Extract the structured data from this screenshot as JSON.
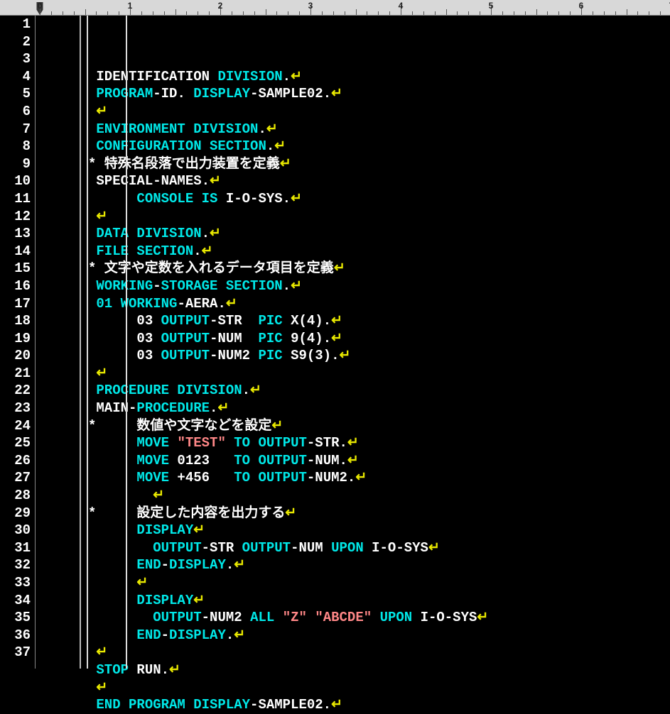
{
  "ruler": {
    "max": 7
  },
  "lines": [
    {
      "n": 1,
      "ind": 0,
      "tokens": [
        {
          "t": "IDENTIFICATION ",
          "c": "w"
        },
        {
          "t": "DIVISION",
          "c": "c"
        },
        {
          "t": ".",
          "c": "w"
        },
        {
          "t": "↵",
          "c": "y"
        }
      ]
    },
    {
      "n": 2,
      "ind": 0,
      "tokens": [
        {
          "t": "PROGRAM",
          "c": "c"
        },
        {
          "t": "-ID. ",
          "c": "w"
        },
        {
          "t": "DISPLAY",
          "c": "c"
        },
        {
          "t": "-SAMPLE02.",
          "c": "w"
        },
        {
          "t": "↵",
          "c": "y"
        }
      ]
    },
    {
      "n": 3,
      "ind": 0,
      "tokens": [
        {
          "t": "↵",
          "c": "y"
        }
      ]
    },
    {
      "n": 4,
      "ind": 0,
      "tokens": [
        {
          "t": "ENVIRONMENT DIVISION",
          "c": "c"
        },
        {
          "t": ".",
          "c": "w"
        },
        {
          "t": "↵",
          "c": "y"
        }
      ]
    },
    {
      "n": 5,
      "ind": 0,
      "tokens": [
        {
          "t": "CONFIGURATION SECTION",
          "c": "c"
        },
        {
          "t": ".",
          "c": "w"
        },
        {
          "t": "↵",
          "c": "y"
        }
      ]
    },
    {
      "n": 6,
      "ind": -1,
      "tokens": [
        {
          "t": "* 特殊名段落で出力装置を定義",
          "c": "w"
        },
        {
          "t": "↵",
          "c": "y"
        }
      ]
    },
    {
      "n": 7,
      "ind": 0,
      "tokens": [
        {
          "t": "SPECIAL-NAMES.",
          "c": "w"
        },
        {
          "t": "↵",
          "c": "y"
        }
      ]
    },
    {
      "n": 8,
      "ind": 1,
      "tokens": [
        {
          "t": "CONSOLE IS",
          "c": "c"
        },
        {
          "t": " I-O-SYS.",
          "c": "w"
        },
        {
          "t": "↵",
          "c": "y"
        }
      ]
    },
    {
      "n": 9,
      "ind": 0,
      "tokens": [
        {
          "t": "↵",
          "c": "y"
        }
      ]
    },
    {
      "n": 10,
      "ind": 0,
      "tokens": [
        {
          "t": "DATA DIVISION",
          "c": "c"
        },
        {
          "t": ".",
          "c": "w"
        },
        {
          "t": "↵",
          "c": "y"
        }
      ]
    },
    {
      "n": 11,
      "ind": 0,
      "tokens": [
        {
          "t": "FILE SECTION",
          "c": "c"
        },
        {
          "t": ".",
          "c": "w"
        },
        {
          "t": "↵",
          "c": "y"
        }
      ]
    },
    {
      "n": 12,
      "ind": -1,
      "tokens": [
        {
          "t": "* 文字や定数を入れるデータ項目を定義",
          "c": "w"
        },
        {
          "t": "↵",
          "c": "y"
        }
      ]
    },
    {
      "n": 13,
      "ind": 0,
      "tokens": [
        {
          "t": "WORKING",
          "c": "c"
        },
        {
          "t": "-",
          "c": "w"
        },
        {
          "t": "STORAGE SECTION",
          "c": "c"
        },
        {
          "t": ".",
          "c": "w"
        },
        {
          "t": "↵",
          "c": "y"
        }
      ]
    },
    {
      "n": 14,
      "ind": 0,
      "tokens": [
        {
          "t": "01",
          "c": "c"
        },
        {
          "t": " ",
          "c": "w"
        },
        {
          "t": "WORKING",
          "c": "c"
        },
        {
          "t": "-AERA.",
          "c": "w"
        },
        {
          "t": "↵",
          "c": "y"
        }
      ]
    },
    {
      "n": 15,
      "ind": 1,
      "tokens": [
        {
          "t": "03",
          "c": "w"
        },
        {
          "t": " ",
          "c": "w"
        },
        {
          "t": "OUTPUT",
          "c": "c"
        },
        {
          "t": "-STR  ",
          "c": "w"
        },
        {
          "t": "PIC",
          "c": "c"
        },
        {
          "t": " X(4).",
          "c": "w"
        },
        {
          "t": "↵",
          "c": "y"
        }
      ]
    },
    {
      "n": 16,
      "ind": 1,
      "tokens": [
        {
          "t": "03",
          "c": "w"
        },
        {
          "t": " ",
          "c": "w"
        },
        {
          "t": "OUTPUT",
          "c": "c"
        },
        {
          "t": "-NUM  ",
          "c": "w"
        },
        {
          "t": "PIC",
          "c": "c"
        },
        {
          "t": " 9(4).",
          "c": "w"
        },
        {
          "t": "↵",
          "c": "y"
        }
      ]
    },
    {
      "n": 17,
      "ind": 1,
      "tokens": [
        {
          "t": "03",
          "c": "w"
        },
        {
          "t": " ",
          "c": "w"
        },
        {
          "t": "OUTPUT",
          "c": "c"
        },
        {
          "t": "-NUM2 ",
          "c": "w"
        },
        {
          "t": "PIC",
          "c": "c"
        },
        {
          "t": " S9(3).",
          "c": "w"
        },
        {
          "t": "↵",
          "c": "y"
        }
      ]
    },
    {
      "n": 18,
      "ind": 0,
      "tokens": [
        {
          "t": "↵",
          "c": "y"
        }
      ]
    },
    {
      "n": 19,
      "ind": 0,
      "tokens": [
        {
          "t": "PROCEDURE DIVISION",
          "c": "c"
        },
        {
          "t": ".",
          "c": "w"
        },
        {
          "t": "↵",
          "c": "y"
        }
      ]
    },
    {
      "n": 20,
      "ind": 0,
      "tokens": [
        {
          "t": "MAIN-",
          "c": "w"
        },
        {
          "t": "PROCEDURE",
          "c": "c"
        },
        {
          "t": ".",
          "c": "w"
        },
        {
          "t": "↵",
          "c": "y"
        }
      ]
    },
    {
      "n": 21,
      "ind": -1,
      "tokens": [
        {
          "t": "*     数値や文字などを設定",
          "c": "w"
        },
        {
          "t": "↵",
          "c": "y"
        }
      ]
    },
    {
      "n": 22,
      "ind": 1,
      "tokens": [
        {
          "t": "MOVE",
          "c": "c"
        },
        {
          "t": " ",
          "c": "w"
        },
        {
          "t": "\"TEST\"",
          "c": "r"
        },
        {
          "t": " ",
          "c": "w"
        },
        {
          "t": "TO",
          "c": "c"
        },
        {
          "t": " ",
          "c": "w"
        },
        {
          "t": "OUTPUT",
          "c": "c"
        },
        {
          "t": "-STR.",
          "c": "w"
        },
        {
          "t": "↵",
          "c": "y"
        }
      ]
    },
    {
      "n": 23,
      "ind": 1,
      "tokens": [
        {
          "t": "MOVE",
          "c": "c"
        },
        {
          "t": " 0123   ",
          "c": "w"
        },
        {
          "t": "TO",
          "c": "c"
        },
        {
          "t": " ",
          "c": "w"
        },
        {
          "t": "OUTPUT",
          "c": "c"
        },
        {
          "t": "-NUM.",
          "c": "w"
        },
        {
          "t": "↵",
          "c": "y"
        }
      ]
    },
    {
      "n": 24,
      "ind": 1,
      "tokens": [
        {
          "t": "MOVE",
          "c": "c"
        },
        {
          "t": " +456   ",
          "c": "w"
        },
        {
          "t": "TO",
          "c": "c"
        },
        {
          "t": " ",
          "c": "w"
        },
        {
          "t": "OUTPUT",
          "c": "c"
        },
        {
          "t": "-NUM2.",
          "c": "w"
        },
        {
          "t": "↵",
          "c": "y"
        }
      ]
    },
    {
      "n": 25,
      "ind": 2,
      "tokens": [
        {
          "t": "↵",
          "c": "y"
        }
      ]
    },
    {
      "n": 26,
      "ind": -1,
      "tokens": [
        {
          "t": "*     設定した内容を出力する",
          "c": "w"
        },
        {
          "t": "↵",
          "c": "y"
        }
      ]
    },
    {
      "n": 27,
      "ind": 1,
      "tokens": [
        {
          "t": "DISPLAY",
          "c": "c"
        },
        {
          "t": "↵",
          "c": "y"
        }
      ]
    },
    {
      "n": 28,
      "ind": 1,
      "tokens": [
        {
          "t": "  ",
          "c": "w"
        },
        {
          "t": "OUTPUT",
          "c": "c"
        },
        {
          "t": "-STR ",
          "c": "w"
        },
        {
          "t": "OUTPUT",
          "c": "c"
        },
        {
          "t": "-NUM ",
          "c": "w"
        },
        {
          "t": "UPON",
          "c": "c"
        },
        {
          "t": " I-O-SYS",
          "c": "w"
        },
        {
          "t": "↵",
          "c": "y"
        }
      ]
    },
    {
      "n": 29,
      "ind": 1,
      "tokens": [
        {
          "t": "END",
          "c": "c"
        },
        {
          "t": "-",
          "c": "w"
        },
        {
          "t": "DISPLAY",
          "c": "c"
        },
        {
          "t": ".",
          "c": "w"
        },
        {
          "t": "↵",
          "c": "y"
        }
      ]
    },
    {
      "n": 30,
      "ind": 1,
      "tokens": [
        {
          "t": "↵",
          "c": "y"
        }
      ]
    },
    {
      "n": 31,
      "ind": 1,
      "tokens": [
        {
          "t": "DISPLAY",
          "c": "c"
        },
        {
          "t": "↵",
          "c": "y"
        }
      ]
    },
    {
      "n": 32,
      "ind": 1,
      "tokens": [
        {
          "t": "  ",
          "c": "w"
        },
        {
          "t": "OUTPUT",
          "c": "c"
        },
        {
          "t": "-NUM2 ",
          "c": "w"
        },
        {
          "t": "ALL",
          "c": "c"
        },
        {
          "t": " ",
          "c": "w"
        },
        {
          "t": "\"Z\"",
          "c": "r"
        },
        {
          "t": " ",
          "c": "w"
        },
        {
          "t": "\"ABCDE\"",
          "c": "r"
        },
        {
          "t": " ",
          "c": "w"
        },
        {
          "t": "UPON",
          "c": "c"
        },
        {
          "t": " I-O-SYS",
          "c": "w"
        },
        {
          "t": "↵",
          "c": "y"
        }
      ]
    },
    {
      "n": 33,
      "ind": 1,
      "tokens": [
        {
          "t": "END",
          "c": "c"
        },
        {
          "t": "-",
          "c": "w"
        },
        {
          "t": "DISPLAY",
          "c": "c"
        },
        {
          "t": ".",
          "c": "w"
        },
        {
          "t": "↵",
          "c": "y"
        }
      ]
    },
    {
      "n": 34,
      "ind": 0,
      "tokens": [
        {
          "t": "↵",
          "c": "y"
        }
      ]
    },
    {
      "n": 35,
      "ind": 0,
      "tokens": [
        {
          "t": "STOP",
          "c": "c"
        },
        {
          "t": " RUN.",
          "c": "w"
        },
        {
          "t": "↵",
          "c": "y"
        }
      ]
    },
    {
      "n": 36,
      "ind": 0,
      "tokens": [
        {
          "t": "↵",
          "c": "y"
        }
      ]
    },
    {
      "n": 37,
      "ind": 0,
      "tokens": [
        {
          "t": "END PROGRAM DISPLAY",
          "c": "c"
        },
        {
          "t": "-SAMPLE02.",
          "c": "w"
        },
        {
          "t": "↵",
          "c": "y"
        }
      ]
    }
  ]
}
